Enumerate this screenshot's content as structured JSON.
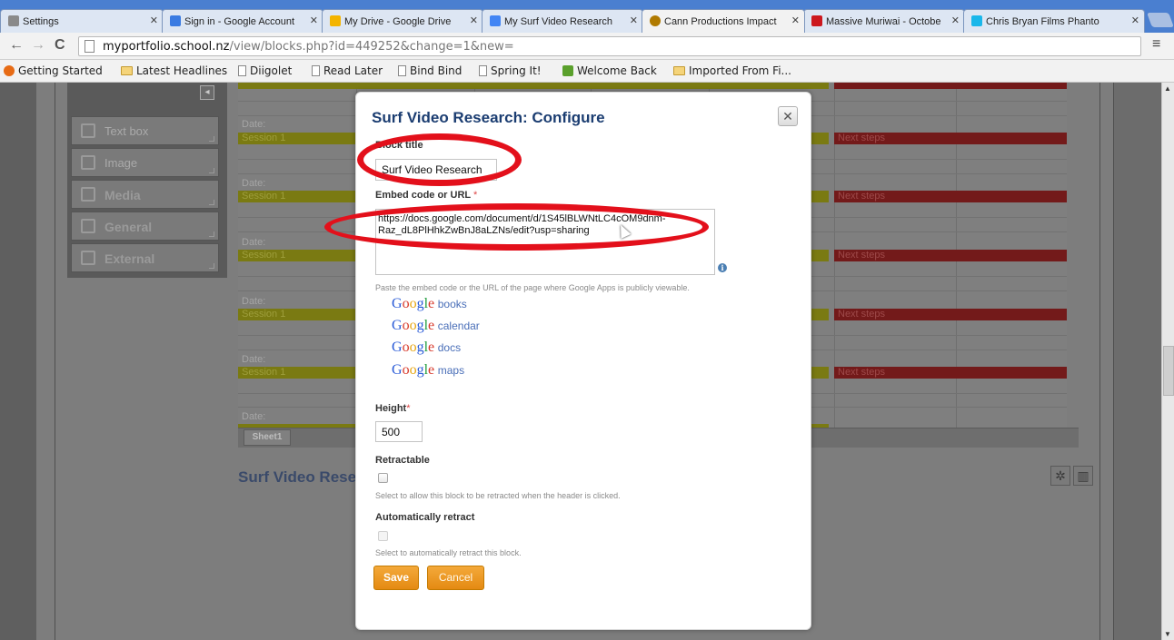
{
  "browser": {
    "tabs": [
      {
        "label": "Settings",
        "icon": "wrench-icon",
        "color": "#777777",
        "active": false
      },
      {
        "label": "Sign in - Google Account",
        "icon": "google-g-icon",
        "color": "#3a7be2",
        "active": false
      },
      {
        "label": "My Drive - Google Drive",
        "icon": "drive-icon",
        "color": "#f4b400",
        "active": false
      },
      {
        "label": "My Surf Video Research",
        "icon": "docs-icon",
        "color": "#4285f4",
        "active": false
      },
      {
        "label": "Cann Productions Impact",
        "icon": "figure-icon",
        "color": "#b07a00",
        "active": true
      },
      {
        "label": "Massive Muriwai - Octobe",
        "icon": "youtube-icon",
        "color": "#cc181e",
        "active": false
      },
      {
        "label": "Chris Bryan Films Phanto",
        "icon": "vimeo-icon",
        "color": "#1ab7ea",
        "active": false
      }
    ],
    "url": {
      "host": "myportfolio.school.nz",
      "path": "/view/blocks.php?id=449252&change=1&new="
    },
    "bookmarks": [
      {
        "label": "Getting Started",
        "icon": "firefox-icon"
      },
      {
        "label": "Latest Headlines",
        "icon": "folder-icon"
      },
      {
        "label": "Diigolet",
        "icon": "page-icon"
      },
      {
        "label": "Read Later",
        "icon": "page-icon"
      },
      {
        "label": "Bind Bind",
        "icon": "page-icon"
      },
      {
        "label": "Spring It!",
        "icon": "page-icon"
      },
      {
        "label": "Welcome Back",
        "icon": "green-icon"
      },
      {
        "label": "Imported From Fi...",
        "icon": "folder-icon"
      }
    ]
  },
  "background": {
    "tools": [
      {
        "label": "Text box",
        "bold": false
      },
      {
        "label": "Image",
        "bold": false
      },
      {
        "label": "Media",
        "bold": true
      },
      {
        "label": "General",
        "bold": true
      },
      {
        "label": "External",
        "bold": true
      }
    ],
    "sheet": {
      "date_label": "Date:",
      "session_label": "Session 1",
      "next_label": "Next steps",
      "tab": "Sheet1"
    },
    "block_heading": "Surf Video Rese"
  },
  "modal": {
    "title": "Surf Video Research: Configure",
    "close_symbol": "✕",
    "block_title_label": "Block title",
    "block_title_value": "Surf Video Research",
    "embed_label": "Embed code or URL",
    "required_mark": "*",
    "embed_value": "https://docs.google.com/document/d/1S45lBLWNtLC4cOM9dnm-Raz_dL8PlHhkZwBnJ8aLZNs/edit?usp=sharing",
    "embed_hint": "Paste the embed code or the URL of the page where Google Apps is publicly viewable.",
    "google_apps": [
      "books",
      "calendar",
      "docs",
      "maps"
    ],
    "height_label": "Height",
    "height_value": "500",
    "retractable_label": "Retractable",
    "retractable_hint": "Select to allow this block to be retracted when the header is clicked.",
    "auto_retract_label": "Automatically retract",
    "auto_retract_hint": "Select to automatically retract this block.",
    "save_label": "Save",
    "cancel_label": "Cancel"
  },
  "colors": {
    "accent_orange": "#e8941f",
    "title_blue": "#1b3d71",
    "annotation_red": "#e3101b"
  }
}
